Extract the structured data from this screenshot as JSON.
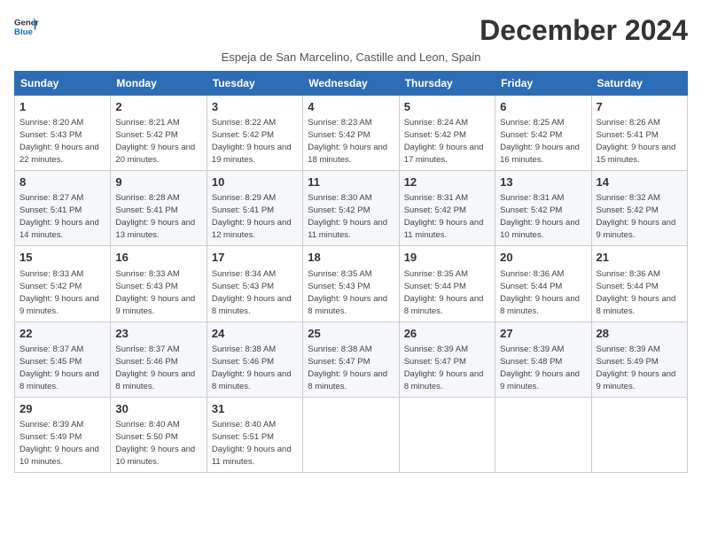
{
  "header": {
    "logo_line1": "General",
    "logo_line2": "Blue",
    "month_title": "December 2024",
    "subtitle": "Espeja de San Marcelino, Castille and Leon, Spain"
  },
  "weekdays": [
    "Sunday",
    "Monday",
    "Tuesday",
    "Wednesday",
    "Thursday",
    "Friday",
    "Saturday"
  ],
  "weeks": [
    [
      {
        "day": "1",
        "sunrise": "Sunrise: 8:20 AM",
        "sunset": "Sunset: 5:43 PM",
        "daylight": "Daylight: 9 hours and 22 minutes."
      },
      {
        "day": "2",
        "sunrise": "Sunrise: 8:21 AM",
        "sunset": "Sunset: 5:42 PM",
        "daylight": "Daylight: 9 hours and 20 minutes."
      },
      {
        "day": "3",
        "sunrise": "Sunrise: 8:22 AM",
        "sunset": "Sunset: 5:42 PM",
        "daylight": "Daylight: 9 hours and 19 minutes."
      },
      {
        "day": "4",
        "sunrise": "Sunrise: 8:23 AM",
        "sunset": "Sunset: 5:42 PM",
        "daylight": "Daylight: 9 hours and 18 minutes."
      },
      {
        "day": "5",
        "sunrise": "Sunrise: 8:24 AM",
        "sunset": "Sunset: 5:42 PM",
        "daylight": "Daylight: 9 hours and 17 minutes."
      },
      {
        "day": "6",
        "sunrise": "Sunrise: 8:25 AM",
        "sunset": "Sunset: 5:42 PM",
        "daylight": "Daylight: 9 hours and 16 minutes."
      },
      {
        "day": "7",
        "sunrise": "Sunrise: 8:26 AM",
        "sunset": "Sunset: 5:41 PM",
        "daylight": "Daylight: 9 hours and 15 minutes."
      }
    ],
    [
      {
        "day": "8",
        "sunrise": "Sunrise: 8:27 AM",
        "sunset": "Sunset: 5:41 PM",
        "daylight": "Daylight: 9 hours and 14 minutes."
      },
      {
        "day": "9",
        "sunrise": "Sunrise: 8:28 AM",
        "sunset": "Sunset: 5:41 PM",
        "daylight": "Daylight: 9 hours and 13 minutes."
      },
      {
        "day": "10",
        "sunrise": "Sunrise: 8:29 AM",
        "sunset": "Sunset: 5:41 PM",
        "daylight": "Daylight: 9 hours and 12 minutes."
      },
      {
        "day": "11",
        "sunrise": "Sunrise: 8:30 AM",
        "sunset": "Sunset: 5:42 PM",
        "daylight": "Daylight: 9 hours and 11 minutes."
      },
      {
        "day": "12",
        "sunrise": "Sunrise: 8:31 AM",
        "sunset": "Sunset: 5:42 PM",
        "daylight": "Daylight: 9 hours and 11 minutes."
      },
      {
        "day": "13",
        "sunrise": "Sunrise: 8:31 AM",
        "sunset": "Sunset: 5:42 PM",
        "daylight": "Daylight: 9 hours and 10 minutes."
      },
      {
        "day": "14",
        "sunrise": "Sunrise: 8:32 AM",
        "sunset": "Sunset: 5:42 PM",
        "daylight": "Daylight: 9 hours and 9 minutes."
      }
    ],
    [
      {
        "day": "15",
        "sunrise": "Sunrise: 8:33 AM",
        "sunset": "Sunset: 5:42 PM",
        "daylight": "Daylight: 9 hours and 9 minutes."
      },
      {
        "day": "16",
        "sunrise": "Sunrise: 8:33 AM",
        "sunset": "Sunset: 5:43 PM",
        "daylight": "Daylight: 9 hours and 9 minutes."
      },
      {
        "day": "17",
        "sunrise": "Sunrise: 8:34 AM",
        "sunset": "Sunset: 5:43 PM",
        "daylight": "Daylight: 9 hours and 8 minutes."
      },
      {
        "day": "18",
        "sunrise": "Sunrise: 8:35 AM",
        "sunset": "Sunset: 5:43 PM",
        "daylight": "Daylight: 9 hours and 8 minutes."
      },
      {
        "day": "19",
        "sunrise": "Sunrise: 8:35 AM",
        "sunset": "Sunset: 5:44 PM",
        "daylight": "Daylight: 9 hours and 8 minutes."
      },
      {
        "day": "20",
        "sunrise": "Sunrise: 8:36 AM",
        "sunset": "Sunset: 5:44 PM",
        "daylight": "Daylight: 9 hours and 8 minutes."
      },
      {
        "day": "21",
        "sunrise": "Sunrise: 8:36 AM",
        "sunset": "Sunset: 5:44 PM",
        "daylight": "Daylight: 9 hours and 8 minutes."
      }
    ],
    [
      {
        "day": "22",
        "sunrise": "Sunrise: 8:37 AM",
        "sunset": "Sunset: 5:45 PM",
        "daylight": "Daylight: 9 hours and 8 minutes."
      },
      {
        "day": "23",
        "sunrise": "Sunrise: 8:37 AM",
        "sunset": "Sunset: 5:46 PM",
        "daylight": "Daylight: 9 hours and 8 minutes."
      },
      {
        "day": "24",
        "sunrise": "Sunrise: 8:38 AM",
        "sunset": "Sunset: 5:46 PM",
        "daylight": "Daylight: 9 hours and 8 minutes."
      },
      {
        "day": "25",
        "sunrise": "Sunrise: 8:38 AM",
        "sunset": "Sunset: 5:47 PM",
        "daylight": "Daylight: 9 hours and 8 minutes."
      },
      {
        "day": "26",
        "sunrise": "Sunrise: 8:39 AM",
        "sunset": "Sunset: 5:47 PM",
        "daylight": "Daylight: 9 hours and 8 minutes."
      },
      {
        "day": "27",
        "sunrise": "Sunrise: 8:39 AM",
        "sunset": "Sunset: 5:48 PM",
        "daylight": "Daylight: 9 hours and 9 minutes."
      },
      {
        "day": "28",
        "sunrise": "Sunrise: 8:39 AM",
        "sunset": "Sunset: 5:49 PM",
        "daylight": "Daylight: 9 hours and 9 minutes."
      }
    ],
    [
      {
        "day": "29",
        "sunrise": "Sunrise: 8:39 AM",
        "sunset": "Sunset: 5:49 PM",
        "daylight": "Daylight: 9 hours and 10 minutes."
      },
      {
        "day": "30",
        "sunrise": "Sunrise: 8:40 AM",
        "sunset": "Sunset: 5:50 PM",
        "daylight": "Daylight: 9 hours and 10 minutes."
      },
      {
        "day": "31",
        "sunrise": "Sunrise: 8:40 AM",
        "sunset": "Sunset: 5:51 PM",
        "daylight": "Daylight: 9 hours and 11 minutes."
      },
      null,
      null,
      null,
      null
    ]
  ]
}
